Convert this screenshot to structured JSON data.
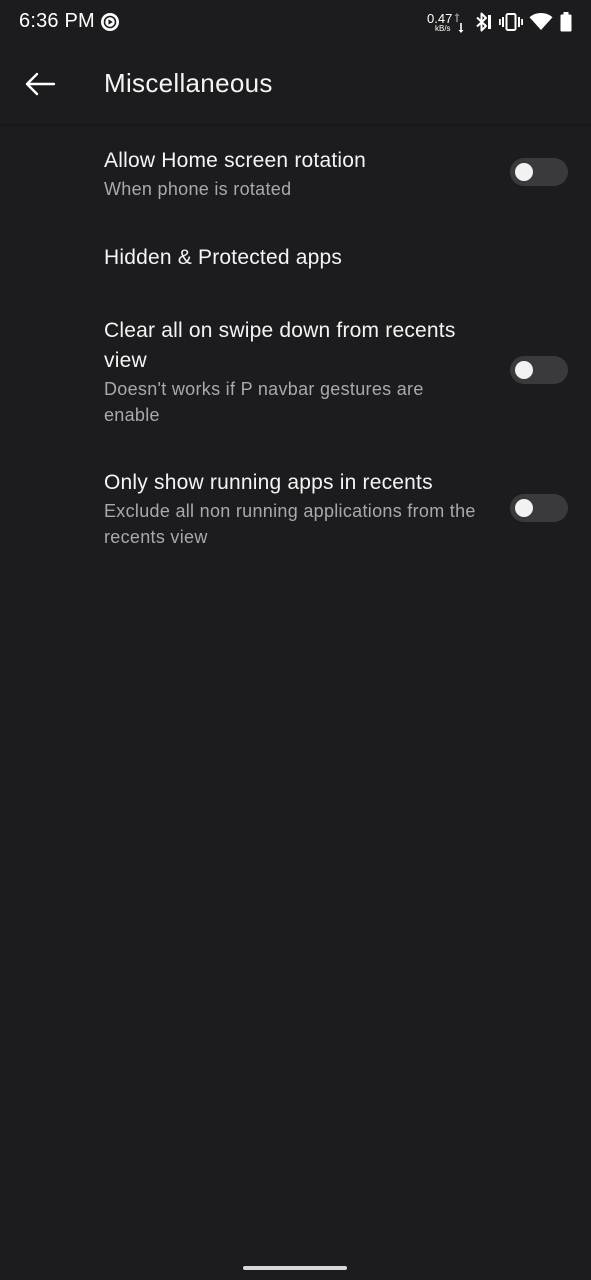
{
  "status_bar": {
    "time": "6:36 PM",
    "net_speed_value": "0.47",
    "net_speed_unit": "kB/s",
    "icons": [
      "media-app-icon",
      "bluetooth-icon",
      "vibrate-icon",
      "wifi-icon",
      "battery-icon"
    ]
  },
  "app_bar": {
    "back_icon": "arrow-left-icon",
    "title": "Miscellaneous"
  },
  "settings": [
    {
      "title": "Allow Home screen rotation",
      "summary": "When phone is rotated",
      "has_switch": true,
      "enabled": false
    },
    {
      "title": "Hidden & Protected apps",
      "summary": "",
      "has_switch": false
    },
    {
      "title": "Clear all on swipe down from recents view",
      "summary": "Doesn't works if P navbar gestures are enable",
      "has_switch": true,
      "enabled": false
    },
    {
      "title": "Only show running apps in recents",
      "summary": "Exclude all non running applications from the recents view",
      "has_switch": true,
      "enabled": false
    }
  ],
  "colors": {
    "background": "#1c1c1e",
    "text_primary": "#f4f4f4",
    "text_secondary": "#a9a9ab",
    "switch_track_off": "#3a3a3c",
    "switch_thumb": "#f2f2f2"
  }
}
